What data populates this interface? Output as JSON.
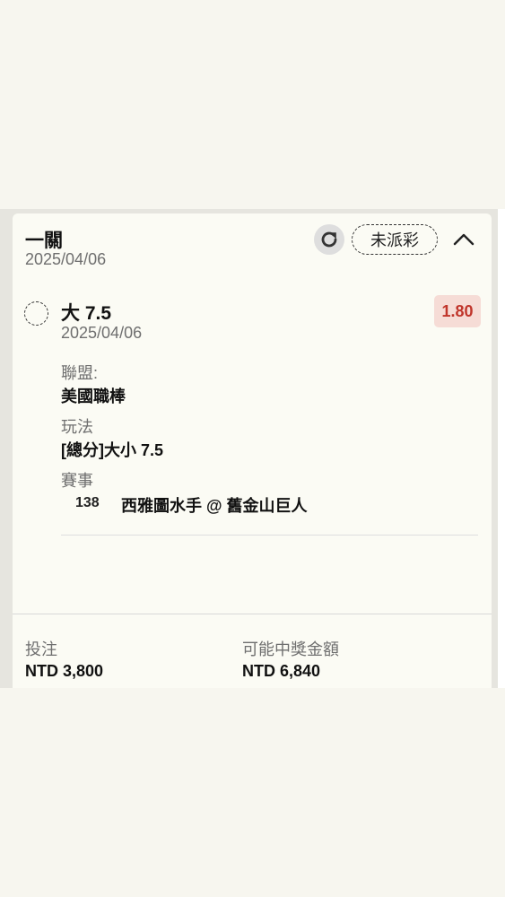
{
  "bet": {
    "type_label": "一關",
    "date": "2025/04/06",
    "status": "未派彩",
    "icons": {
      "refresh": "refresh-icon",
      "collapse": "chevron-up-icon",
      "pick": "dashed-circle-icon"
    }
  },
  "selection": {
    "name": "大 7.5",
    "date": "2025/04/06",
    "odds": "1.80",
    "league_label": "聯盟:",
    "league": "美國職棒",
    "market_label": "玩法",
    "market": "[總分]大小 7.5",
    "event_label": "賽事",
    "event_id": "138",
    "event_name": "西雅圖水手 @ 舊金山巨人"
  },
  "footer": {
    "stake_label": "投注",
    "stake": "NTD 3,800",
    "payout_label": "可能中獎金額",
    "payout": "NTD 6,840"
  },
  "colors": {
    "odds_text": "#c0352b",
    "odds_bg": "#f6dcd6",
    "page_bg": "#f7f6ef"
  }
}
